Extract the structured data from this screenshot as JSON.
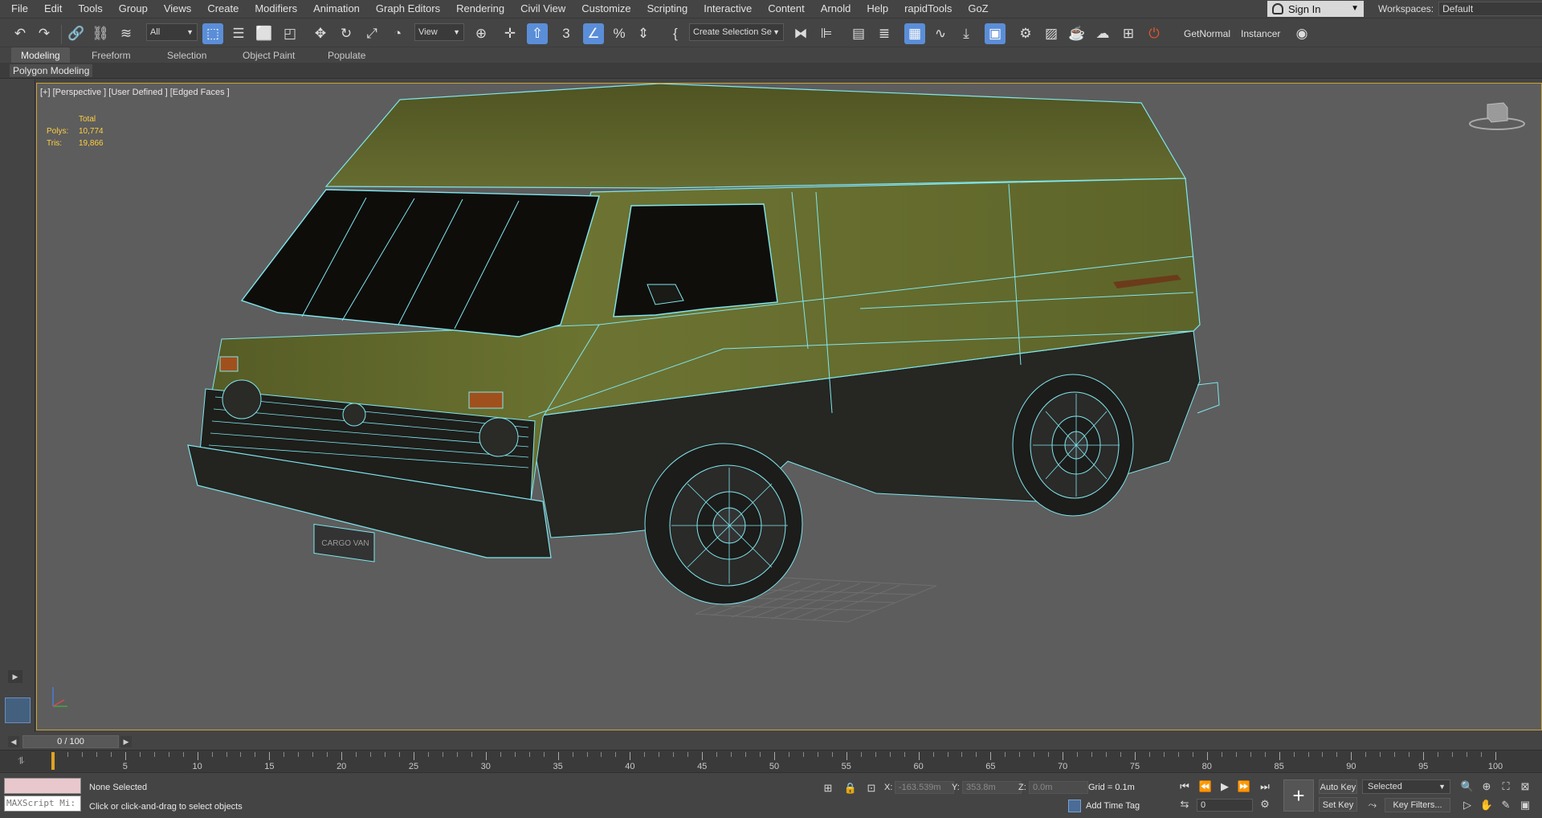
{
  "menu": [
    "File",
    "Edit",
    "Tools",
    "Group",
    "Views",
    "Create",
    "Modifiers",
    "Animation",
    "Graph Editors",
    "Rendering",
    "Civil View",
    "Customize",
    "Scripting",
    "Interactive",
    "Content",
    "Arnold",
    "Help",
    "rapidTools",
    "GoZ"
  ],
  "signin": "Sign In",
  "workspaces": {
    "label": "Workspaces:",
    "value": "Default"
  },
  "toolbar": {
    "filter_select": "All",
    "view_select": "View",
    "selection_set": "Create Selection Se",
    "getnormal": "GetNormal",
    "instancer": "Instancer"
  },
  "ribbon_tabs": [
    "Modeling",
    "Freeform",
    "Selection",
    "Object Paint",
    "Populate"
  ],
  "ribbon_active": "Polygon Modeling",
  "viewport": {
    "label": "[+] [Perspective ] [User Defined ] [Edged Faces ]",
    "stats": {
      "header": "Total",
      "polys_label": "Polys:",
      "polys": "10,774",
      "tris_label": "Tris:",
      "tris": "19,866"
    },
    "plate_text": "CARGO VAN"
  },
  "timeline": {
    "slider": "0 / 100",
    "ticks": [
      5,
      10,
      15,
      20,
      25,
      30,
      35,
      40,
      45,
      50,
      55,
      60,
      65,
      70,
      75,
      80,
      85,
      90,
      95,
      100
    ],
    "current_frame": 0
  },
  "status": {
    "maxscript_placeholder": "MAXScript Mi:",
    "selection": "None Selected",
    "prompt": "Click or click-and-drag to select objects",
    "x_label": "X:",
    "x_value": "-163.539m",
    "y_label": "Y:",
    "y_value": "353.8m",
    "z_label": "Z:",
    "z_value": "0.0m",
    "grid": "Grid = 0.1m",
    "add_time_tag": "Add Time Tag",
    "frame": "0",
    "auto_key": "Auto Key",
    "set_key": "Set Key",
    "key_select": "Selected",
    "key_filters": "Key Filters..."
  },
  "colors": {
    "viewport_border": "#c8a23a",
    "active_blue": "#5b8ed8",
    "stats_yellow": "#ffcf40",
    "van_body": "#5a6228",
    "wire": "#7fe7ef"
  }
}
